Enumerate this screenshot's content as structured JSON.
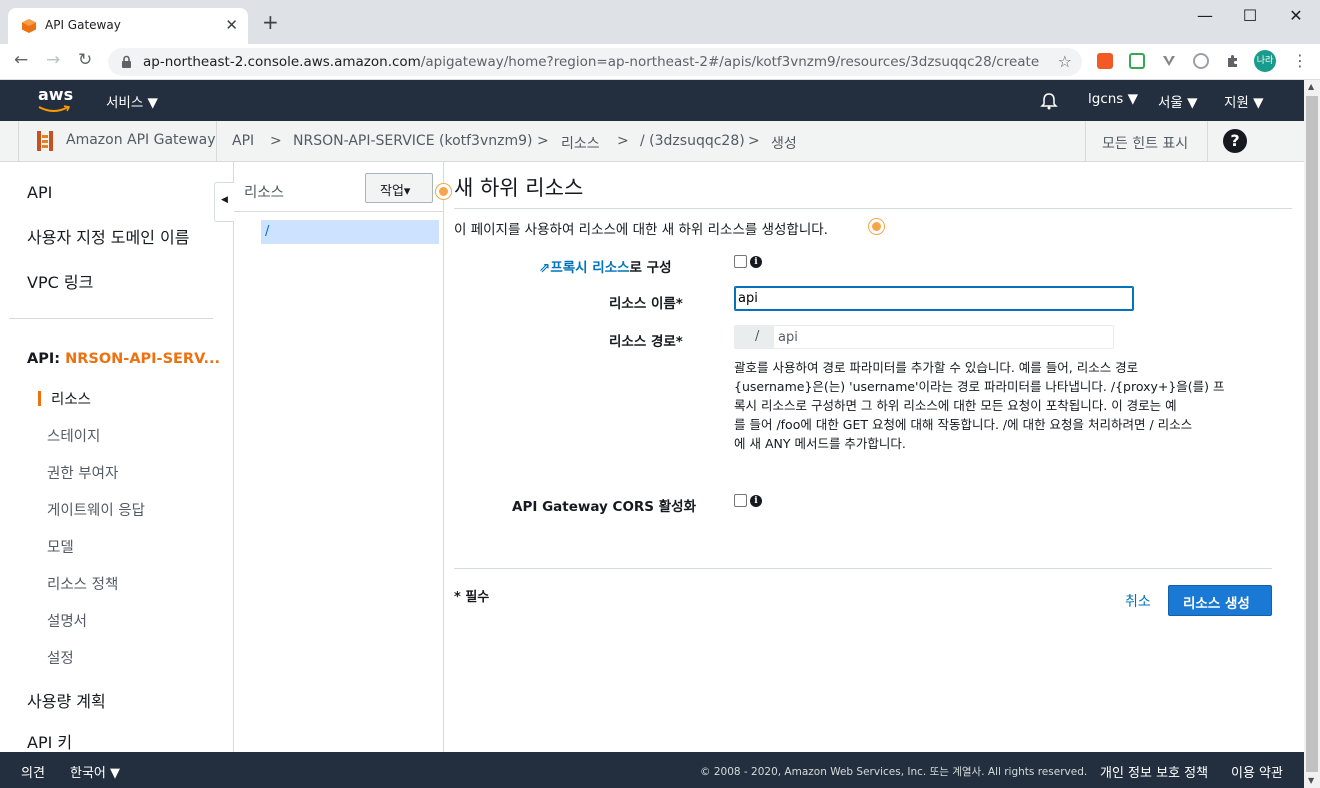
{
  "browser": {
    "tab_title": "API Gateway",
    "tab_close": "✕",
    "new_tab": "+",
    "url_host": "ap-northeast-2.console.aws.amazon.com",
    "url_path": "/apigateway/home?region=ap-northeast-2#/apis/kotf3vnzm9/resources/3dzsuqqc28/create",
    "profile_label": "나라",
    "win_min": "—",
    "win_max": "☐",
    "win_close": "✕"
  },
  "aws_header": {
    "logo": "aws",
    "services": "서비스 ▼",
    "account": "lgcns ▼",
    "region": "서울 ▼",
    "support": "지원 ▼"
  },
  "breadcrumb": {
    "service": "Amazon API Gateway",
    "items": [
      "API",
      ">",
      "NRSON-API-SERVICE (kotf3vnzm9)",
      ">",
      "리소스",
      ">",
      "/ (3dzsuqqc28)",
      ">",
      "생성"
    ],
    "hints": "모든 힌트 표시",
    "help": "?"
  },
  "sidebar": {
    "top_items": [
      "API",
      "사용자 지정 도메인 이름",
      "VPC 링크"
    ],
    "api_prefix": "API: ",
    "api_name": "NRSON-API-SERV...",
    "sub_items": [
      "리소스",
      "스테이지",
      "권한 부여자",
      "게이트웨이 응답",
      "모델",
      "리소스 정책",
      "설명서",
      "설정"
    ],
    "bottom_items": [
      "사용량 계획",
      "API 키"
    ]
  },
  "tree": {
    "header": "리소스",
    "actions": "작업▾",
    "root": "/"
  },
  "form": {
    "title": "새 하위 리소스",
    "description": "이 페이지를 사용하여 리소스에 대한 새 하위 리소스를 생성합니다.",
    "proxy_link": "프록시 리소스",
    "proxy_suffix": "로 구성",
    "name_label": "리소스 이름*",
    "name_value": "api",
    "path_label": "리소스 경로*",
    "path_prefix": "/",
    "path_value": "api",
    "help_lines": [
      "괄호를 사용하여 경로 파라미터를 추가할 수 있습니다. 예를 들어, 리소스 경로",
      "{username}은(는) 'username'이라는 경로 파라미터를 나타냅니다. /{proxy+}을(를) 프",
      "록시 리소스로 구성하면 그 하위 리소스에 대한 모든 요청이 포착됩니다. 이 경로는 예",
      "를 들어 /foo에 대한 GET 요청에 대해 작동합니다. /에 대한 요청을 처리하려면 / 리소스",
      "에 새 ANY 메서드를 추가합니다."
    ],
    "cors_label": "API Gateway CORS 활성화",
    "required": "* 필수",
    "cancel": "취소",
    "create": "리소스 생성"
  },
  "footer": {
    "feedback": "의견",
    "language": "한국어 ▼",
    "copyright": "© 2008 - 2020, Amazon Web Services, Inc. 또는 계열사. All rights reserved.",
    "privacy": "개인 정보 보호 정책",
    "terms": "이용 약관"
  },
  "colors": {
    "aws_dark": "#232f3e",
    "accent_orange": "#ec7211",
    "link_blue": "#0073bb",
    "primary_button": "#0972d3"
  }
}
